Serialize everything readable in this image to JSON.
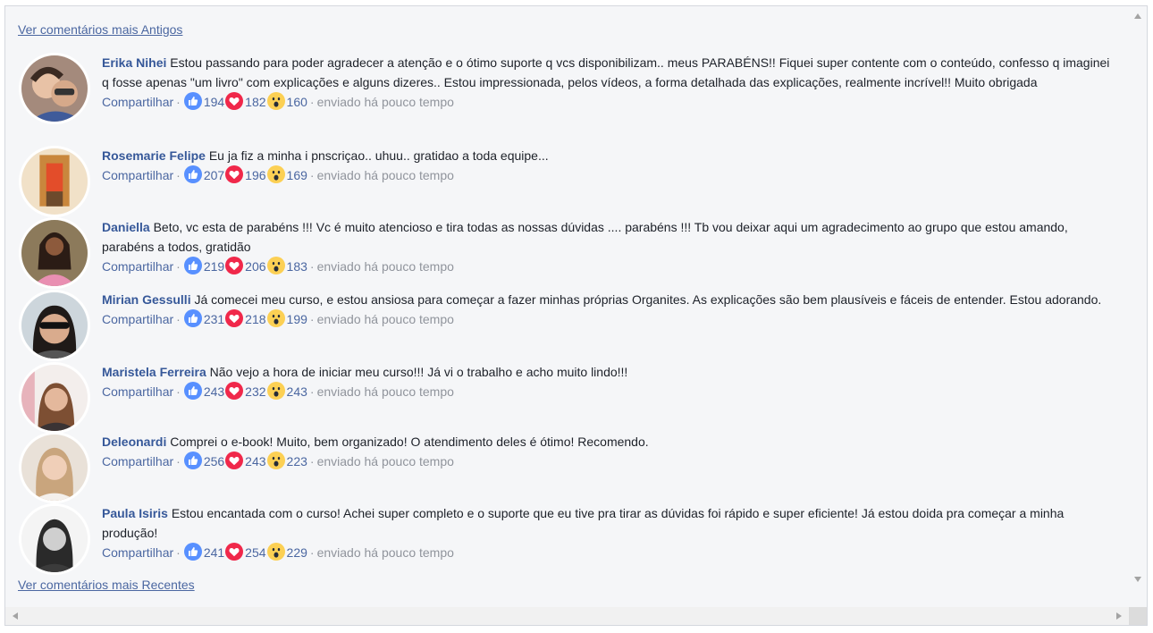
{
  "links": {
    "older": "Ver comentários mais Antigos",
    "newer": "Ver comentários mais Recentes"
  },
  "comments": [
    {
      "author": "Erika Nihei",
      "text": "Estou passando para poder agradecer a atenção e o ótimo suporte q vcs disponibilizam.. meus PARABÉNS!! Fiquei super contente com o conteúdo, confesso q imaginei q fosse apenas \"um livro\" com explicações e alguns dizeres.. Estou impressionada, pelos vídeos, a forma detalhada das explicações, realmente incrível!! Muito obrigada",
      "share": "Compartilhar",
      "likes": "194",
      "loves": "182",
      "wows": "160",
      "time": "enviado há pouco tempo"
    },
    {
      "author": "Rosemarie Felipe",
      "text": "Eu ja fiz a minha i pnscriçao.. uhuu.. gratidao a toda equipe...",
      "share": "Compartilhar",
      "likes": "207",
      "loves": "196",
      "wows": "169",
      "time": "enviado há pouco tempo"
    },
    {
      "author": "Daniella",
      "text": "Beto, vc esta de parabéns !!! Vc é muito atencioso e tira todas as nossas dúvidas .... parabéns !!! Tb vou deixar aqui um agradecimento ao grupo que estou amando, parabéns a todos, gratidão",
      "share": "Compartilhar",
      "likes": "219",
      "loves": "206",
      "wows": "183",
      "time": "enviado há pouco tempo"
    },
    {
      "author": "Mirian Gessulli",
      "text": "Já comecei meu curso, e estou ansiosa para começar a fazer minhas próprias Organites. As explicações são bem plausíveis e fáceis de entender. Estou adorando.",
      "share": "Compartilhar",
      "likes": "231",
      "loves": "218",
      "wows": "199",
      "time": "enviado há pouco tempo"
    },
    {
      "author": "Maristela Ferreira",
      "text": "Não vejo a hora de iniciar meu curso!!! Já vi o trabalho e acho muito lindo!!!",
      "share": "Compartilhar",
      "likes": "243",
      "loves": "232",
      "wows": "243",
      "time": "enviado há pouco tempo"
    },
    {
      "author": "Deleonardi",
      "text": "Comprei o e-book! Muito, bem organizado! O atendimento deles é ótimo! Recomendo.",
      "share": "Compartilhar",
      "likes": "256",
      "loves": "243",
      "wows": "223",
      "time": "enviado há pouco tempo"
    },
    {
      "author": "Paula Isiris",
      "text": "Estou encantada com o curso! Achei super completo e o suporte que eu tive pra tirar as dúvidas foi rápido e super eficiente! Já estou doida pra começar a minha produção!",
      "share": "Compartilhar",
      "likes": "241",
      "loves": "254",
      "wows": "229",
      "time": "enviado há pouco tempo"
    }
  ],
  "colors": {
    "author": "#365899",
    "link": "#4b67a1",
    "meta": "#90949c",
    "like": "#5890ff",
    "love": "#f0284a",
    "wow": "#fcd054",
    "background": "#f5f6f8"
  },
  "icons": {
    "like": "thumbs-up-icon",
    "love": "heart-icon",
    "wow": "wow-face-icon"
  }
}
